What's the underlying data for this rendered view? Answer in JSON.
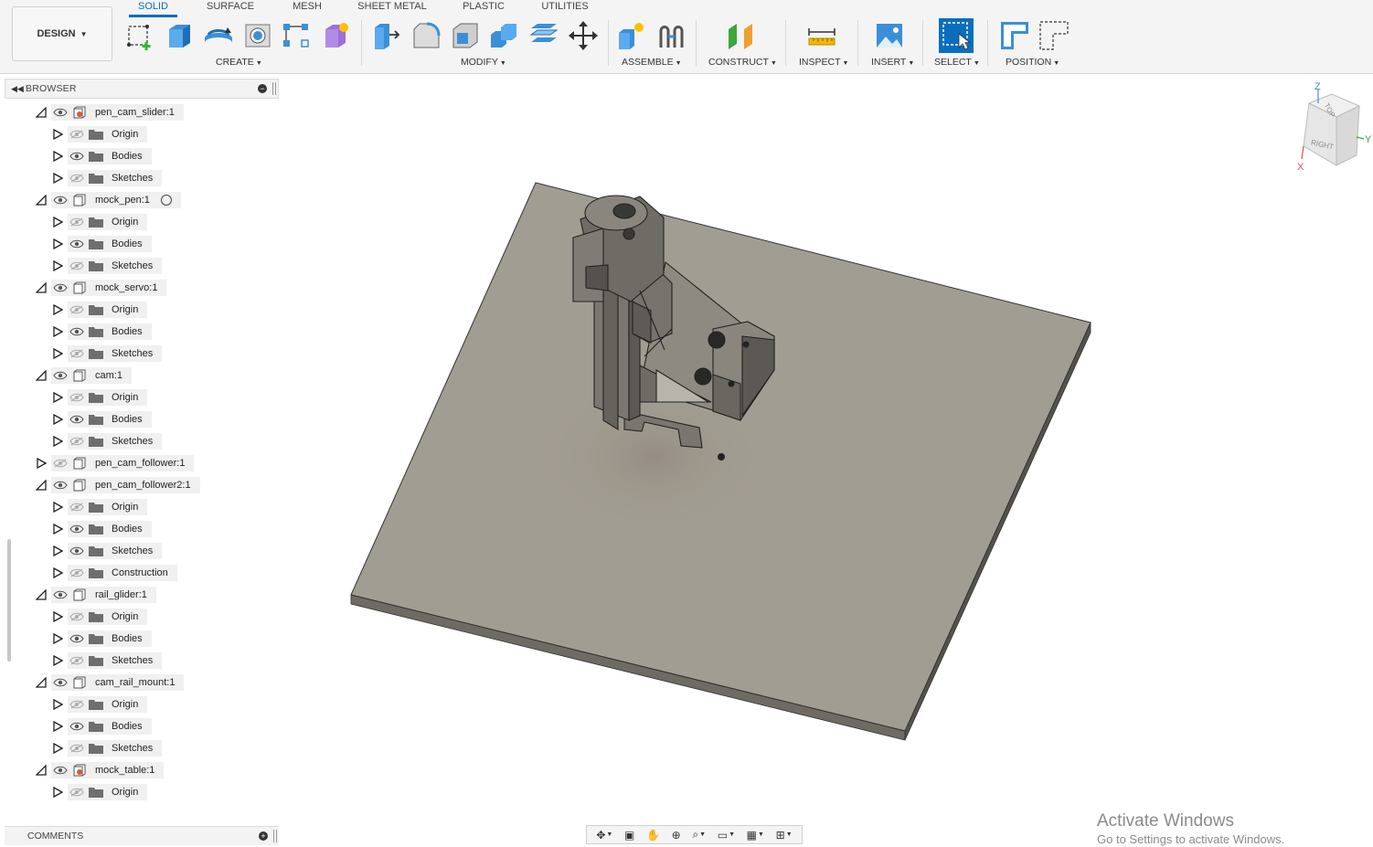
{
  "design_button": {
    "label": "DESIGN"
  },
  "tabs": [
    {
      "label": "SOLID",
      "active": true
    },
    {
      "label": "SURFACE"
    },
    {
      "label": "MESH"
    },
    {
      "label": "SHEET METAL"
    },
    {
      "label": "PLASTIC"
    },
    {
      "label": "UTILITIES"
    }
  ],
  "groups": {
    "create": "CREATE",
    "modify": "MODIFY",
    "assemble": "ASSEMBLE",
    "construct": "CONSTRUCT",
    "inspect": "INSPECT",
    "insert": "INSERT",
    "select": "SELECT",
    "position": "POSITION"
  },
  "browser": {
    "title": "BROWSER",
    "items": [
      {
        "label": "pen_cam_slider:1",
        "level": 0,
        "expanded": true,
        "visible": true,
        "icon": "component-linked-icon"
      },
      {
        "label": "Origin",
        "level": 1,
        "visible": false,
        "icon": "folder-icon"
      },
      {
        "label": "Bodies",
        "level": 1,
        "visible": true,
        "icon": "folder-icon"
      },
      {
        "label": "Sketches",
        "level": 1,
        "visible": false,
        "icon": "folder-icon"
      },
      {
        "label": "mock_pen:1",
        "level": 0,
        "expanded": true,
        "visible": true,
        "icon": "component-icon",
        "radio": true
      },
      {
        "label": "Origin",
        "level": 1,
        "visible": false,
        "icon": "folder-icon"
      },
      {
        "label": "Bodies",
        "level": 1,
        "visible": true,
        "icon": "folder-icon"
      },
      {
        "label": "Sketches",
        "level": 1,
        "visible": false,
        "icon": "folder-icon"
      },
      {
        "label": "mock_servo:1",
        "level": 0,
        "expanded": true,
        "visible": true,
        "icon": "component-icon"
      },
      {
        "label": "Origin",
        "level": 1,
        "visible": false,
        "icon": "folder-icon"
      },
      {
        "label": "Bodies",
        "level": 1,
        "visible": true,
        "icon": "folder-icon"
      },
      {
        "label": "Sketches",
        "level": 1,
        "visible": false,
        "icon": "folder-icon"
      },
      {
        "label": "cam:1",
        "level": 0,
        "expanded": true,
        "visible": true,
        "icon": "component-icon"
      },
      {
        "label": "Origin",
        "level": 1,
        "visible": false,
        "icon": "folder-icon"
      },
      {
        "label": "Bodies",
        "level": 1,
        "visible": true,
        "icon": "folder-icon"
      },
      {
        "label": "Sketches",
        "level": 1,
        "visible": false,
        "icon": "folder-icon"
      },
      {
        "label": "pen_cam_follower:1",
        "level": 0,
        "expanded": false,
        "visible": false,
        "icon": "component-icon"
      },
      {
        "label": "pen_cam_follower2:1",
        "level": 0,
        "expanded": true,
        "visible": true,
        "icon": "component-icon"
      },
      {
        "label": "Origin",
        "level": 1,
        "visible": false,
        "icon": "folder-icon"
      },
      {
        "label": "Bodies",
        "level": 1,
        "visible": true,
        "icon": "folder-icon"
      },
      {
        "label": "Sketches",
        "level": 1,
        "visible": true,
        "icon": "folder-icon"
      },
      {
        "label": "Construction",
        "level": 1,
        "visible": false,
        "icon": "folder-icon"
      },
      {
        "label": "rail_glider:1",
        "level": 0,
        "expanded": true,
        "visible": true,
        "icon": "component-icon"
      },
      {
        "label": "Origin",
        "level": 1,
        "visible": false,
        "icon": "folder-icon"
      },
      {
        "label": "Bodies",
        "level": 1,
        "visible": true,
        "icon": "folder-icon"
      },
      {
        "label": "Sketches",
        "level": 1,
        "visible": false,
        "icon": "folder-icon"
      },
      {
        "label": "cam_rail_mount:1",
        "level": 0,
        "expanded": true,
        "visible": true,
        "icon": "component-icon"
      },
      {
        "label": "Origin",
        "level": 1,
        "visible": false,
        "icon": "folder-icon"
      },
      {
        "label": "Bodies",
        "level": 1,
        "visible": true,
        "icon": "folder-icon"
      },
      {
        "label": "Sketches",
        "level": 1,
        "visible": false,
        "icon": "folder-icon"
      },
      {
        "label": "mock_table:1",
        "level": 0,
        "expanded": true,
        "visible": true,
        "icon": "component-linked-icon"
      },
      {
        "label": "Origin",
        "level": 1,
        "visible": false,
        "icon": "folder-icon"
      }
    ]
  },
  "comments": {
    "title": "COMMENTS"
  },
  "viewcube": {
    "top": "TOP",
    "right": "RIGHT",
    "axis_z": "Z",
    "axis_y": "Y",
    "axis_x": "X"
  },
  "watermark": {
    "line1": "Activate Windows",
    "line2": "Go to Settings to activate Windows."
  },
  "colors": {
    "accent": "#0a6ebd",
    "model": "#a29d92",
    "plate_edge": "#6f6b63"
  }
}
